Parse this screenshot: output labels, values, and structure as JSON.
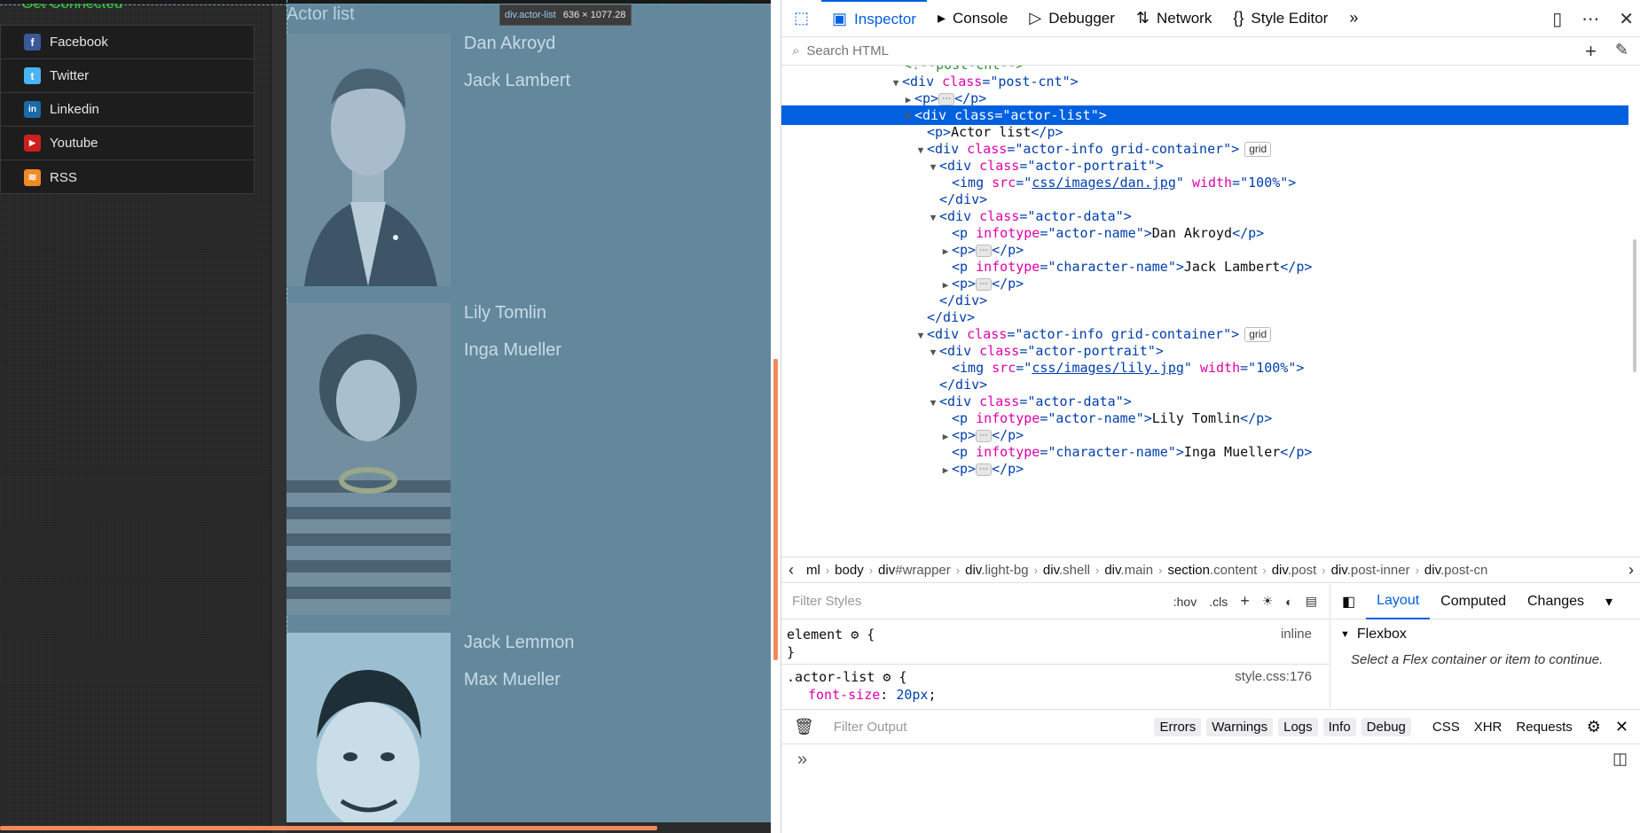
{
  "page": {
    "get_connected": "Get Connected",
    "social": [
      {
        "label": "Facebook",
        "icon": "facebook-icon",
        "glyph": "f",
        "color": "#3b5998"
      },
      {
        "label": "Twitter",
        "icon": "twitter-icon",
        "glyph": "t",
        "color": "#4ab3f4"
      },
      {
        "label": "Linkedin",
        "icon": "linkedin-icon",
        "glyph": "in",
        "color": "#1a6aa8"
      },
      {
        "label": "Youtube",
        "icon": "youtube-icon",
        "glyph": "▶",
        "color": "#cc1f1f"
      },
      {
        "label": "RSS",
        "icon": "rss-icon",
        "glyph": "≋",
        "color": "#f08a24"
      }
    ],
    "tooltip": {
      "selector": "div.actor-list",
      "dims": "636 × 1077.28"
    },
    "actor_list_title": "Actor list",
    "actors": [
      {
        "name": "Dan Akroyd",
        "character": "Jack Lambert"
      },
      {
        "name": "Lily Tomlin",
        "character": "Inga Mueller"
      },
      {
        "name": "Jack Lemmon",
        "character": "Max Mueller"
      }
    ]
  },
  "devtools": {
    "tabs": {
      "inspector": "Inspector",
      "console": "Console",
      "debugger": "Debugger",
      "network": "Network",
      "style_editor": "Style Editor"
    },
    "search_placeholder": "Search HTML",
    "markup": {
      "comment": "<!--post-cnt-->",
      "post_cnt_class": "post-cnt",
      "actor_list_class": "actor-list",
      "p_actor_list": "Actor list",
      "actor_info_class": "actor-info grid-container",
      "grid_badge": "grid",
      "portrait_class": "actor-portrait",
      "img1_src": "css/images/dan.jpg",
      "img2_src": "css/images/lily.jpg",
      "img_width": "100%",
      "data_class": "actor-data",
      "infotype_actor": "actor-name",
      "infotype_char": "character-name",
      "ellipsis": "⋯"
    },
    "breadcrumbs": [
      {
        "tag": "ml",
        "cls": ""
      },
      {
        "tag": "body",
        "cls": ""
      },
      {
        "tag": "div",
        "cls": "#wrapper"
      },
      {
        "tag": "div",
        "cls": ".light-bg"
      },
      {
        "tag": "div",
        "cls": ".shell"
      },
      {
        "tag": "div",
        "cls": ".main"
      },
      {
        "tag": "section",
        "cls": ".content"
      },
      {
        "tag": "div",
        "cls": ".post"
      },
      {
        "tag": "div",
        "cls": ".post-inner"
      },
      {
        "tag": "div",
        "cls": ".post-cn"
      }
    ],
    "rules": {
      "filter_placeholder": "Filter Styles",
      "hov": ":hov",
      "cls": ".cls",
      "element_selector": "element",
      "element_source": "inline",
      "rule_selector": ".actor-list",
      "rule_source": "style.css:176",
      "prop": "font-size",
      "value": "20px"
    },
    "layout": {
      "tabs": [
        "Layout",
        "Computed",
        "Changes"
      ],
      "flexbox": "Flexbox",
      "message": "Select a Flex container or item to continue."
    },
    "console": {
      "filter_placeholder": "Filter Output",
      "buttons": [
        "Errors",
        "Warnings",
        "Logs",
        "Info",
        "Debug"
      ],
      "plain": [
        "CSS",
        "XHR",
        "Requests"
      ]
    }
  }
}
